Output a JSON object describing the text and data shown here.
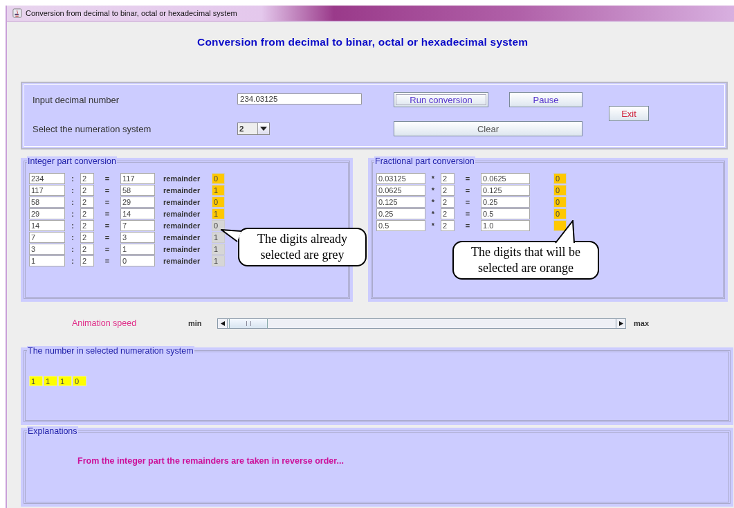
{
  "window": {
    "title": "Conversion from decimal to binar, octal or hexadecimal system"
  },
  "heading": "Conversion from decimal to binar, octal or hexadecimal system",
  "input": {
    "label": "Input decimal number",
    "value": "234.03125",
    "system_label": "Select the numeration system",
    "system_value": "2"
  },
  "buttons": [
    {
      "label": "Run conversion",
      "kind": "focused"
    },
    {
      "label": "Pause",
      "kind": "normal"
    },
    {
      "label": "Exit",
      "kind": "danger"
    },
    {
      "label": "Clear",
      "kind": "plain"
    }
  ],
  "integer_part": {
    "title": "Integer part conversion",
    "operator": ":",
    "equals": "=",
    "rows": [
      {
        "dividend": "234",
        "divisor": "2",
        "quotient": "117",
        "label": "remainder",
        "digit": "0",
        "color": "#ffc800"
      },
      {
        "dividend": "117",
        "divisor": "2",
        "quotient": "58",
        "label": "remainder",
        "digit": "1",
        "color": "#ffc800"
      },
      {
        "dividend": "58",
        "divisor": "2",
        "quotient": "29",
        "label": "remainder",
        "digit": "0",
        "color": "#ffc800"
      },
      {
        "dividend": "29",
        "divisor": "2",
        "quotient": "14",
        "label": "remainder",
        "digit": "1",
        "color": "#ffc800"
      },
      {
        "dividend": "14",
        "divisor": "2",
        "quotient": "7",
        "label": "remainder",
        "digit": "0",
        "color": "#d6d6d6"
      },
      {
        "dividend": "7",
        "divisor": "2",
        "quotient": "3",
        "label": "remainder",
        "digit": "1",
        "color": "#d6d6d6"
      },
      {
        "dividend": "3",
        "divisor": "2",
        "quotient": "1",
        "label": "remainder",
        "digit": "1",
        "color": "#d6d6d6"
      },
      {
        "dividend": "1",
        "divisor": "2",
        "quotient": "0",
        "label": "remainder",
        "digit": "1",
        "color": "#d6d6d6"
      }
    ],
    "callout": "The digits already selected are grey"
  },
  "fractional_part": {
    "title": "Fractional part conversion",
    "operator": "*",
    "equals": "=",
    "rows": [
      {
        "factor": "0.03125",
        "multiplier": "2",
        "product": "0.0625",
        "digit": "0",
        "color": "#ffc800"
      },
      {
        "factor": "0.0625",
        "multiplier": "2",
        "product": "0.125",
        "digit": "0",
        "color": "#ffc800"
      },
      {
        "factor": "0.125",
        "multiplier": "2",
        "product": "0.25",
        "digit": "0",
        "color": "#ffc800"
      },
      {
        "factor": "0.25",
        "multiplier": "2",
        "product": "0.5",
        "digit": "0",
        "color": "#ffc800"
      },
      {
        "factor": "0.5",
        "multiplier": "2",
        "product": "1.0",
        "color": "#ffc800"
      }
    ],
    "callout": "The digits that will be selected are orange"
  },
  "speed": {
    "label": "Animation speed",
    "min": "min",
    "max": "max"
  },
  "result": {
    "title": "The number in selected numeration system",
    "digits": [
      "1",
      "1",
      "1",
      "0"
    ]
  },
  "explanations": {
    "title": "Explanations",
    "text": "From the integer part the remainders are taken in reverse order..."
  }
}
